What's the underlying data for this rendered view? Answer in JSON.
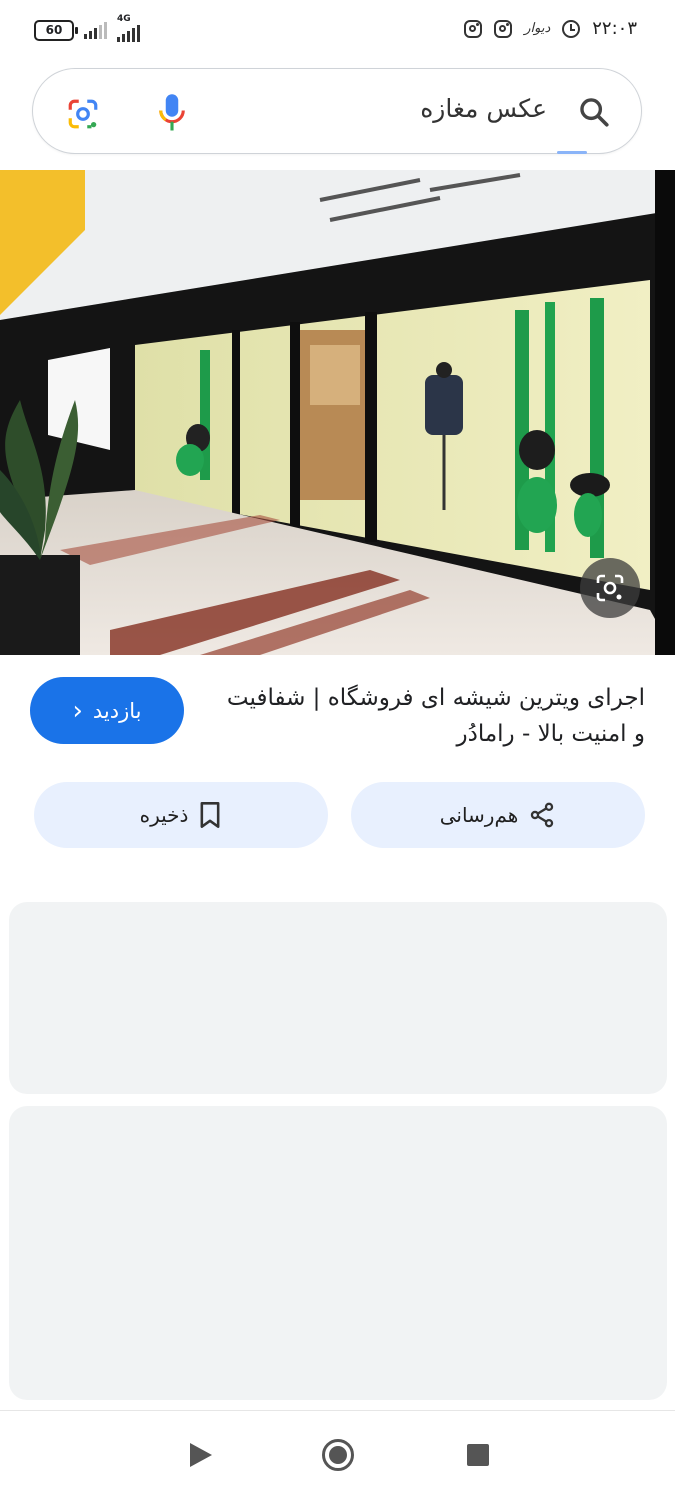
{
  "status_bar": {
    "battery": "60",
    "network": "4G",
    "app_label": "دیوار",
    "time": "۲۲:۰۳"
  },
  "search": {
    "query": "عکس مغازه"
  },
  "result": {
    "title": "اجرای ویترین شیشه ای فروشگاه | شفافیت و امنیت بالا - رامادُر",
    "visit_label": "بازدید",
    "visit_chevron": "‹"
  },
  "actions": {
    "share_label": "هم‌رسانی",
    "save_label": "ذخیره"
  },
  "colors": {
    "accent": "#1a73e8",
    "chip_bg": "#e8f0fe",
    "card_bg": "#f1f3f4"
  },
  "icons": [
    "search-icon",
    "mic-icon",
    "google-lens-icon",
    "share-icon",
    "bookmark-icon",
    "instagram-icon",
    "alarm-icon",
    "back-icon",
    "home-icon",
    "recents-icon"
  ]
}
